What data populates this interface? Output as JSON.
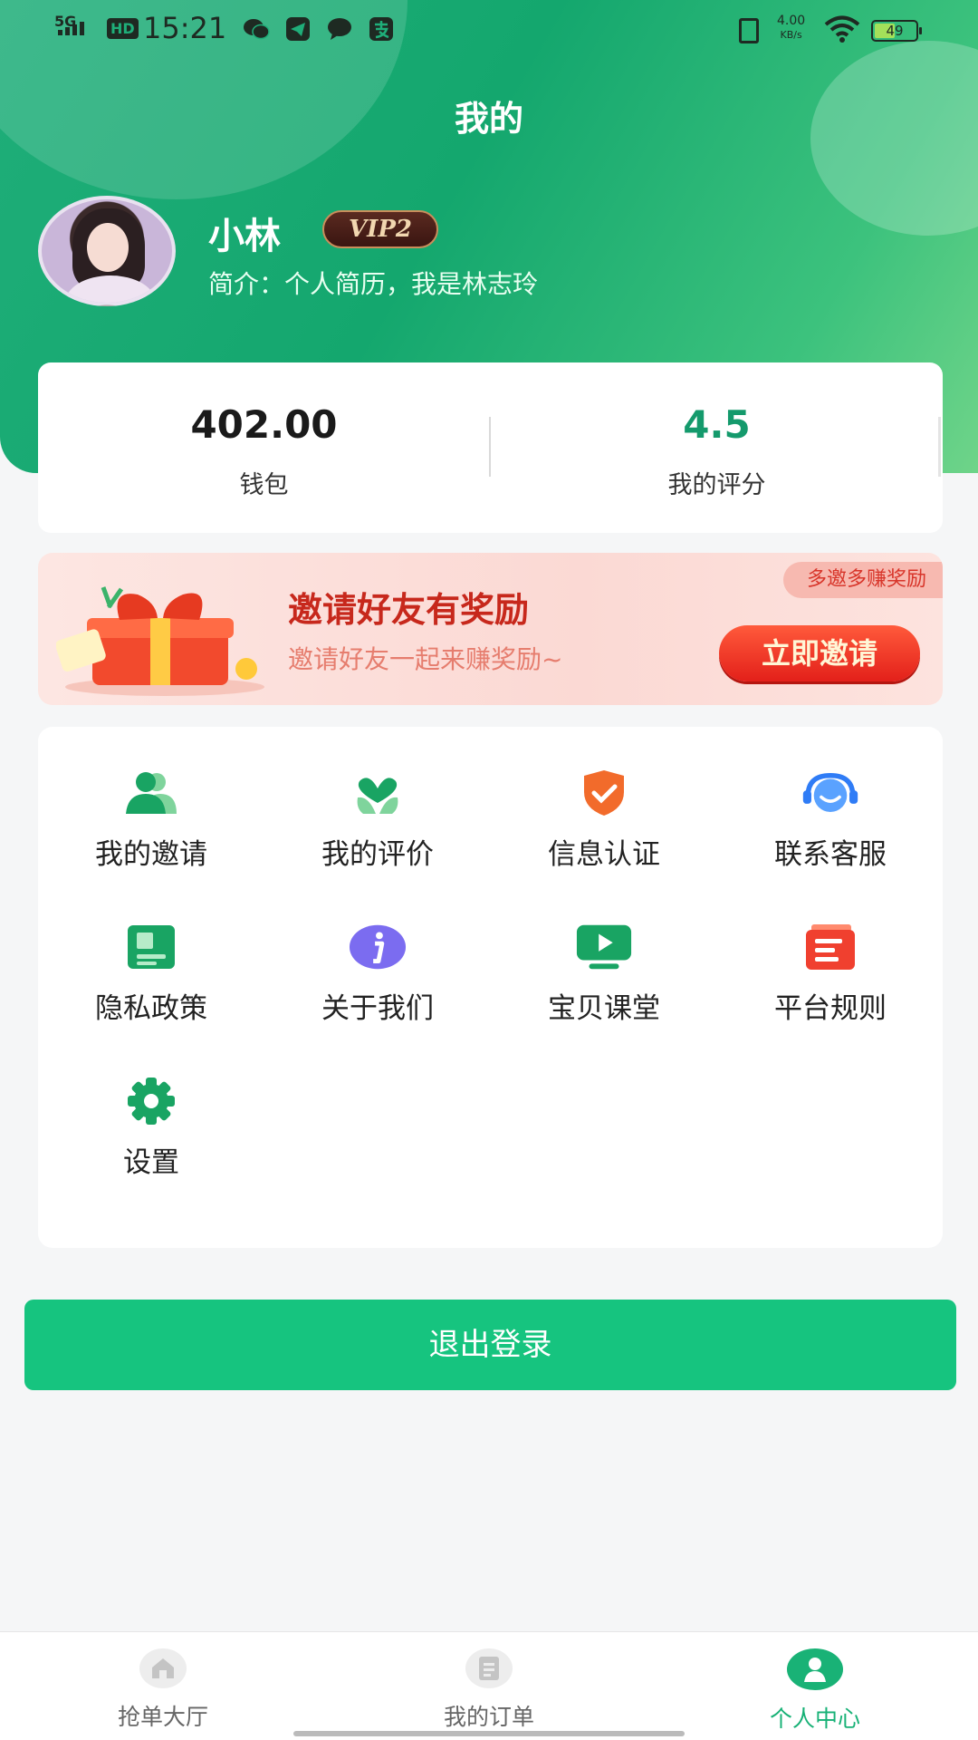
{
  "status_bar": {
    "network": "5G",
    "hd": "HD",
    "time": "15:21",
    "net_speed_value": "4.00",
    "net_speed_unit": "KB/s",
    "battery": "49",
    "battery_level": 0.49
  },
  "header": {
    "title": "我的"
  },
  "profile": {
    "name": "小林",
    "vip_badge": "VIP2",
    "bio": "简介：个人简历，我是林志玲"
  },
  "stats": {
    "wallet_value": "402.00",
    "wallet_label": "钱包",
    "rating_value": "4.5",
    "rating_label": "我的评分"
  },
  "banner": {
    "tag": "多邀多赚奖励",
    "title": "邀请好友有奖励",
    "subtitle": "邀请好友一起来赚奖励~",
    "button": "立即邀请"
  },
  "menu": {
    "items": [
      {
        "label": "我的邀请",
        "icon": "users-icon",
        "color": "#1aa464"
      },
      {
        "label": "我的评价",
        "icon": "heart-plant-icon",
        "color": "#1aa464"
      },
      {
        "label": "信息认证",
        "icon": "shield-check-icon",
        "color": "#f26b2b"
      },
      {
        "label": "联系客服",
        "icon": "headset-icon",
        "color": "#2f7cf6"
      },
      {
        "label": "隐私政策",
        "icon": "document-icon",
        "color": "#1aa464"
      },
      {
        "label": "关于我们",
        "icon": "info-icon",
        "color": "#7b6cf0"
      },
      {
        "label": "宝贝课堂",
        "icon": "video-play-icon",
        "color": "#1aa464"
      },
      {
        "label": "平台规则",
        "icon": "rules-list-icon",
        "color": "#f0402f"
      },
      {
        "label": "设置",
        "icon": "gear-icon",
        "color": "#1aa464"
      }
    ]
  },
  "logout_label": "退出登录",
  "tabbar": {
    "tabs": [
      {
        "label": "抢单大厅",
        "icon": "home-icon"
      },
      {
        "label": "我的订单",
        "icon": "order-list-icon"
      },
      {
        "label": "个人中心",
        "icon": "person-icon",
        "active": true
      }
    ]
  },
  "colors": {
    "primary": "#16c47f",
    "header_green": "#14a76e",
    "accent_red": "#e3201a"
  }
}
